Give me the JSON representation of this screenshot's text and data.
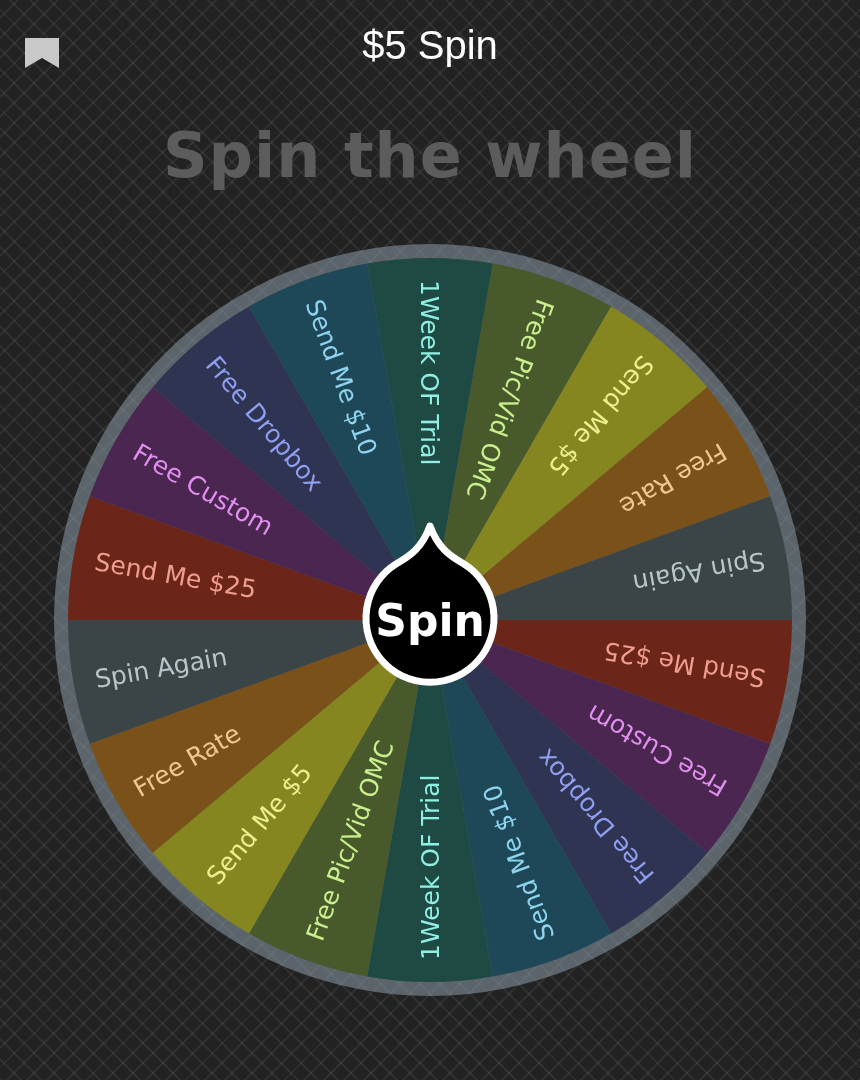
{
  "header": {
    "title": "$5 Spin"
  },
  "heading": "Spin the wheel",
  "wheel": {
    "button": "Spin",
    "segments": [
      {
        "label": "1Week OF Trial",
        "color": "#1f4a44"
      },
      {
        "label": "Free Pic/Vid OMC",
        "color": "#485a2c"
      },
      {
        "label": "Send Me $5",
        "color": "#85861f"
      },
      {
        "label": "Free Rate",
        "color": "#7a5119"
      },
      {
        "label": "Spin Again",
        "color": "#3b4547"
      },
      {
        "label": "Send Me $25",
        "color": "#6c2619"
      },
      {
        "label": "Free Custom",
        "color": "#4a2650"
      },
      {
        "label": "Free Dropbox",
        "color": "#2f3452"
      },
      {
        "label": "Send Me $10",
        "color": "#1e4858"
      },
      {
        "label": "1Week OF Trial",
        "color": "#1f4a44"
      },
      {
        "label": "Free Pic/Vid OMC",
        "color": "#485a2c"
      },
      {
        "label": "Send Me $5",
        "color": "#85861f"
      },
      {
        "label": "Free Rate",
        "color": "#7a5119"
      },
      {
        "label": "Spin Again",
        "color": "#3b4547"
      },
      {
        "label": "Send Me $25",
        "color": "#6c2619"
      },
      {
        "label": "Free Custom",
        "color": "#4a2650"
      },
      {
        "label": "Free Dropbox",
        "color": "#2f3452"
      },
      {
        "label": "Send Me $10",
        "color": "#1e4858"
      }
    ]
  }
}
